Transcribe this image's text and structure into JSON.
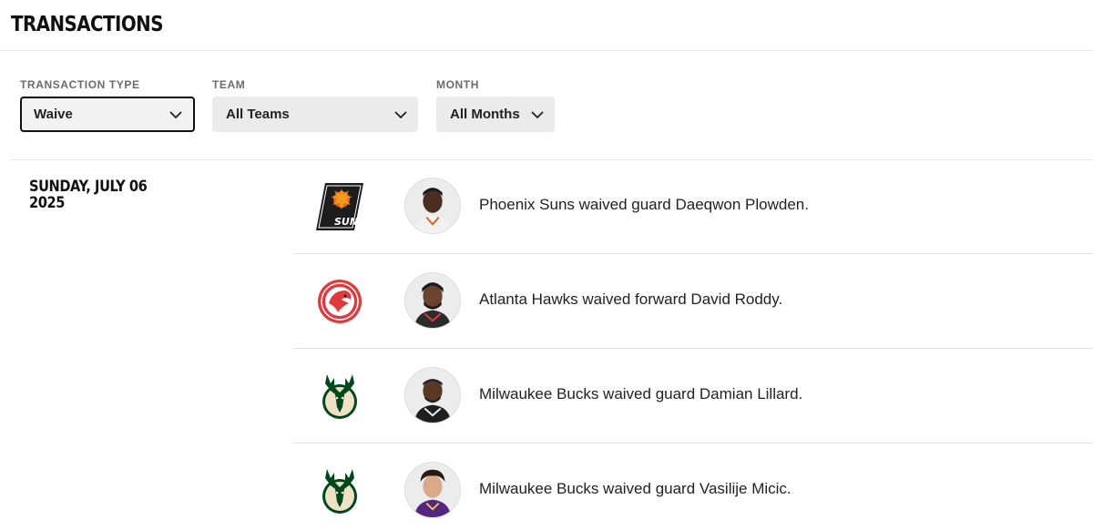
{
  "page": {
    "title": "TRANSACTIONS"
  },
  "filters": {
    "type": {
      "label": "TRANSACTION TYPE",
      "value": "Waive"
    },
    "team": {
      "label": "TEAM",
      "value": "All Teams"
    },
    "month": {
      "label": "MONTH",
      "value": "All Months"
    }
  },
  "date_group": {
    "line1": "SUNDAY, JULY 06",
    "line2": "2025"
  },
  "transactions": [
    {
      "team": "Phoenix Suns",
      "logo_icon": "phoenix-suns-logo-icon",
      "text": "Phoenix Suns waived guard Daeqwon Plowden.",
      "logo_wordmark": "SUNS"
    },
    {
      "team": "Atlanta Hawks",
      "logo_icon": "atlanta-hawks-logo-icon",
      "text": "Atlanta Hawks waived forward David Roddy."
    },
    {
      "team": "Milwaukee Bucks",
      "logo_icon": "milwaukee-bucks-logo-icon",
      "text": "Milwaukee Bucks waived guard Damian Lillard."
    },
    {
      "team": "Milwaukee Bucks",
      "logo_icon": "milwaukee-bucks-logo-icon",
      "text": "Milwaukee Bucks waived guard Vasilije Micic."
    }
  ],
  "colors": {
    "suns_black": "#1d1d1d",
    "suns_orange": "#e56020",
    "hawks_red": "#e03a3e",
    "bucks_green": "#00471b",
    "bucks_cream": "#eee1c6"
  }
}
